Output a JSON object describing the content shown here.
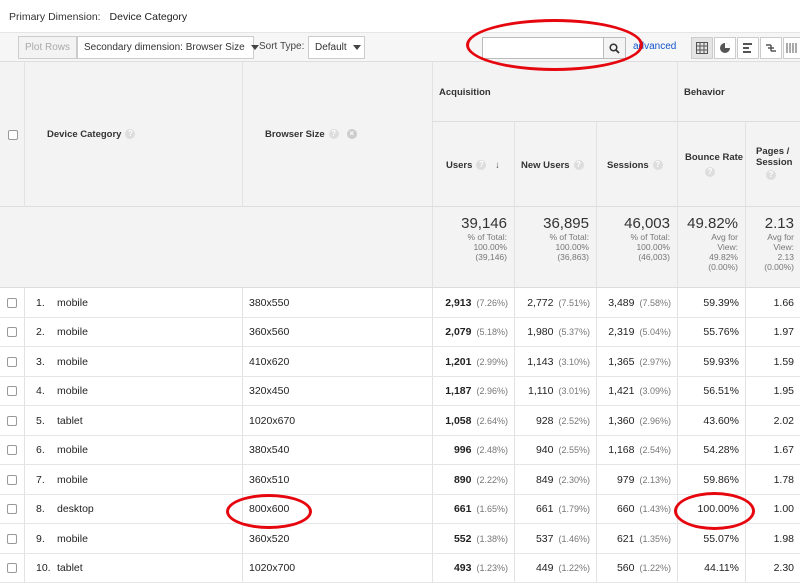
{
  "primary_dimension": {
    "label": "Primary Dimension:",
    "value": "Device Category"
  },
  "toolbar": {
    "plot_rows": "Plot Rows",
    "secondary_dimension": "Secondary dimension: Browser Size",
    "sort_type_label": "Sort Type:",
    "sort_type_value": "Default",
    "search_value": "",
    "advanced": "advanced"
  },
  "header": {
    "device_category": "Device Category",
    "browser_size": "Browser Size",
    "acquisition": "Acquisition",
    "behavior": "Behavior",
    "users": "Users",
    "new_users": "New Users",
    "sessions": "Sessions",
    "bounce_rate": "Bounce Rate",
    "pages_session": "Pages / Session"
  },
  "totals": {
    "users": {
      "value": "39,146",
      "l1": "% of Total:",
      "l2": "100.00%",
      "l3": "(39,146)"
    },
    "new_users": {
      "value": "36,895",
      "l1": "% of Total:",
      "l2": "100.00%",
      "l3": "(36,863)"
    },
    "sessions": {
      "value": "46,003",
      "l1": "% of Total:",
      "l2": "100.00%",
      "l3": "(46,003)"
    },
    "bounce_rate": {
      "value": "49.82%",
      "l1": "Avg for",
      "l2": "View:",
      "l3": "49.82%",
      "l4": "(0.00%)"
    },
    "pages_session": {
      "value": "2.13",
      "l1": "Avg for",
      "l2": "View:",
      "l3": "2.13",
      "l4": "(0.00%)"
    }
  },
  "rows": [
    {
      "idx": "1.",
      "device": "mobile",
      "size": "380x550",
      "users": "2,913",
      "users_pct": "(7.26%)",
      "new_users": "2,772",
      "new_users_pct": "(7.51%)",
      "sessions": "3,489",
      "sessions_pct": "(7.58%)",
      "bounce": "59.39%",
      "pages": "1.66"
    },
    {
      "idx": "2.",
      "device": "mobile",
      "size": "360x560",
      "users": "2,079",
      "users_pct": "(5.18%)",
      "new_users": "1,980",
      "new_users_pct": "(5.37%)",
      "sessions": "2,319",
      "sessions_pct": "(5.04%)",
      "bounce": "55.76%",
      "pages": "1.97"
    },
    {
      "idx": "3.",
      "device": "mobile",
      "size": "410x620",
      "users": "1,201",
      "users_pct": "(2.99%)",
      "new_users": "1,143",
      "new_users_pct": "(3.10%)",
      "sessions": "1,365",
      "sessions_pct": "(2.97%)",
      "bounce": "59.93%",
      "pages": "1.59"
    },
    {
      "idx": "4.",
      "device": "mobile",
      "size": "320x450",
      "users": "1,187",
      "users_pct": "(2.96%)",
      "new_users": "1,110",
      "new_users_pct": "(3.01%)",
      "sessions": "1,421",
      "sessions_pct": "(3.09%)",
      "bounce": "56.51%",
      "pages": "1.95"
    },
    {
      "idx": "5.",
      "device": "tablet",
      "size": "1020x670",
      "users": "1,058",
      "users_pct": "(2.64%)",
      "new_users": "928",
      "new_users_pct": "(2.52%)",
      "sessions": "1,360",
      "sessions_pct": "(2.96%)",
      "bounce": "43.60%",
      "pages": "2.02"
    },
    {
      "idx": "6.",
      "device": "mobile",
      "size": "380x540",
      "users": "996",
      "users_pct": "(2.48%)",
      "new_users": "940",
      "new_users_pct": "(2.55%)",
      "sessions": "1,168",
      "sessions_pct": "(2.54%)",
      "bounce": "54.28%",
      "pages": "1.67"
    },
    {
      "idx": "7.",
      "device": "mobile",
      "size": "360x510",
      "users": "890",
      "users_pct": "(2.22%)",
      "new_users": "849",
      "new_users_pct": "(2.30%)",
      "sessions": "979",
      "sessions_pct": "(2.13%)",
      "bounce": "59.86%",
      "pages": "1.78"
    },
    {
      "idx": "8.",
      "device": "desktop",
      "size": "800x600",
      "users": "661",
      "users_pct": "(1.65%)",
      "new_users": "661",
      "new_users_pct": "(1.79%)",
      "sessions": "660",
      "sessions_pct": "(1.43%)",
      "bounce": "100.00%",
      "pages": "1.00"
    },
    {
      "idx": "9.",
      "device": "mobile",
      "size": "360x520",
      "users": "552",
      "users_pct": "(1.38%)",
      "new_users": "537",
      "new_users_pct": "(1.46%)",
      "sessions": "621",
      "sessions_pct": "(1.35%)",
      "bounce": "55.07%",
      "pages": "1.98"
    },
    {
      "idx": "10.",
      "device": "tablet",
      "size": "1020x700",
      "users": "493",
      "users_pct": "(1.23%)",
      "new_users": "449",
      "new_users_pct": "(1.22%)",
      "sessions": "560",
      "sessions_pct": "(1.22%)",
      "bounce": "44.11%",
      "pages": "2.30"
    }
  ]
}
